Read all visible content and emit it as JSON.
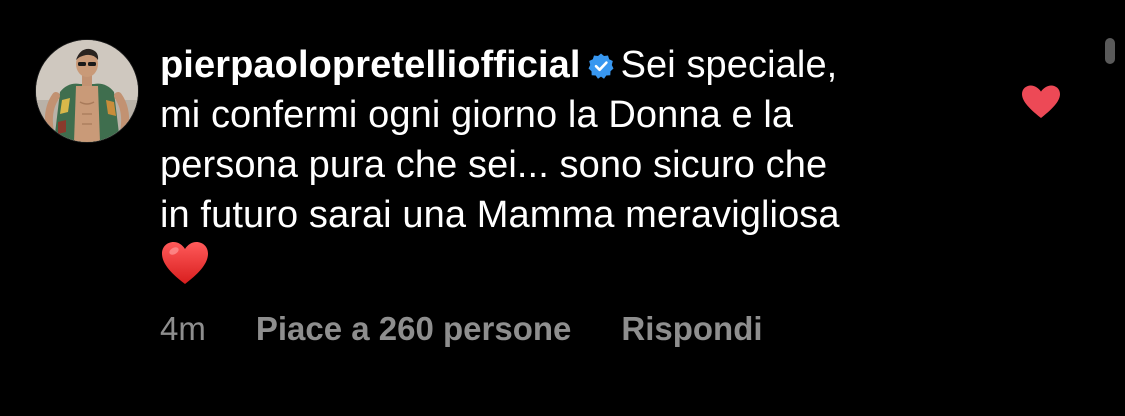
{
  "comment": {
    "username": "pierpaolopretelliofficial",
    "verified": true,
    "text_lines": [
      "Sei speciale,",
      "mi confermi ogni giorno la Donna e la",
      "persona pura che sei... sono sicuro che",
      "in futuro sarai una Mamma meravigliosa"
    ],
    "emoji": "heart-emoji",
    "time": "4m",
    "likes_label": "Piace a 260 persone",
    "reply_label": "Rispondi",
    "liked": true
  },
  "icons": {
    "avatar": "profile-avatar",
    "verified": "verified-badge-icon",
    "like": "heart-icon"
  },
  "colors": {
    "background": "#000000",
    "text": "#ffffff",
    "secondary": "#8e8e8e",
    "verified": "#3897f0",
    "like_heart": "#ed4956"
  }
}
